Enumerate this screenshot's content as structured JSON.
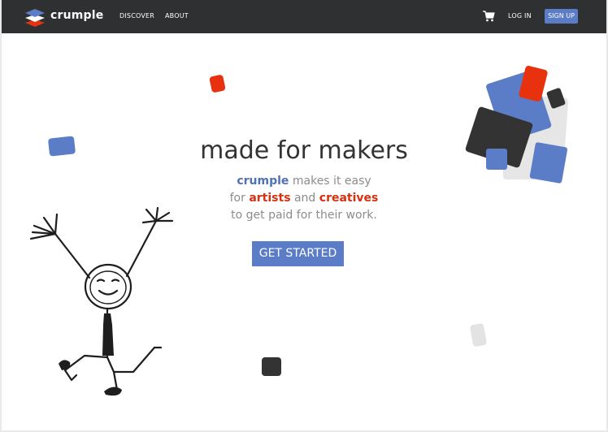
{
  "nav": {
    "brand": "crumple",
    "links": [
      "DISCOVER",
      "ABOUT"
    ],
    "login": "LOG IN",
    "signup": "SIGN UP",
    "icons": {
      "logo": "layered-stack-logo",
      "cart": "shopping-cart-icon"
    }
  },
  "hero": {
    "title": "made for makers",
    "line1": {
      "brand": "crumple",
      "rest": " makes it easy"
    },
    "line2": {
      "pre": "for ",
      "artists": "artists",
      "mid": " and ",
      "creatives": "creatives"
    },
    "line3": "to get paid for their work.",
    "cta": "GET STARTED"
  },
  "colors": {
    "navbar": "#2f3032",
    "accent_blue": "#5b7cc6",
    "accent_red": "#e8320f",
    "dark": "#333333",
    "light_gray": "#e3e3e3"
  }
}
